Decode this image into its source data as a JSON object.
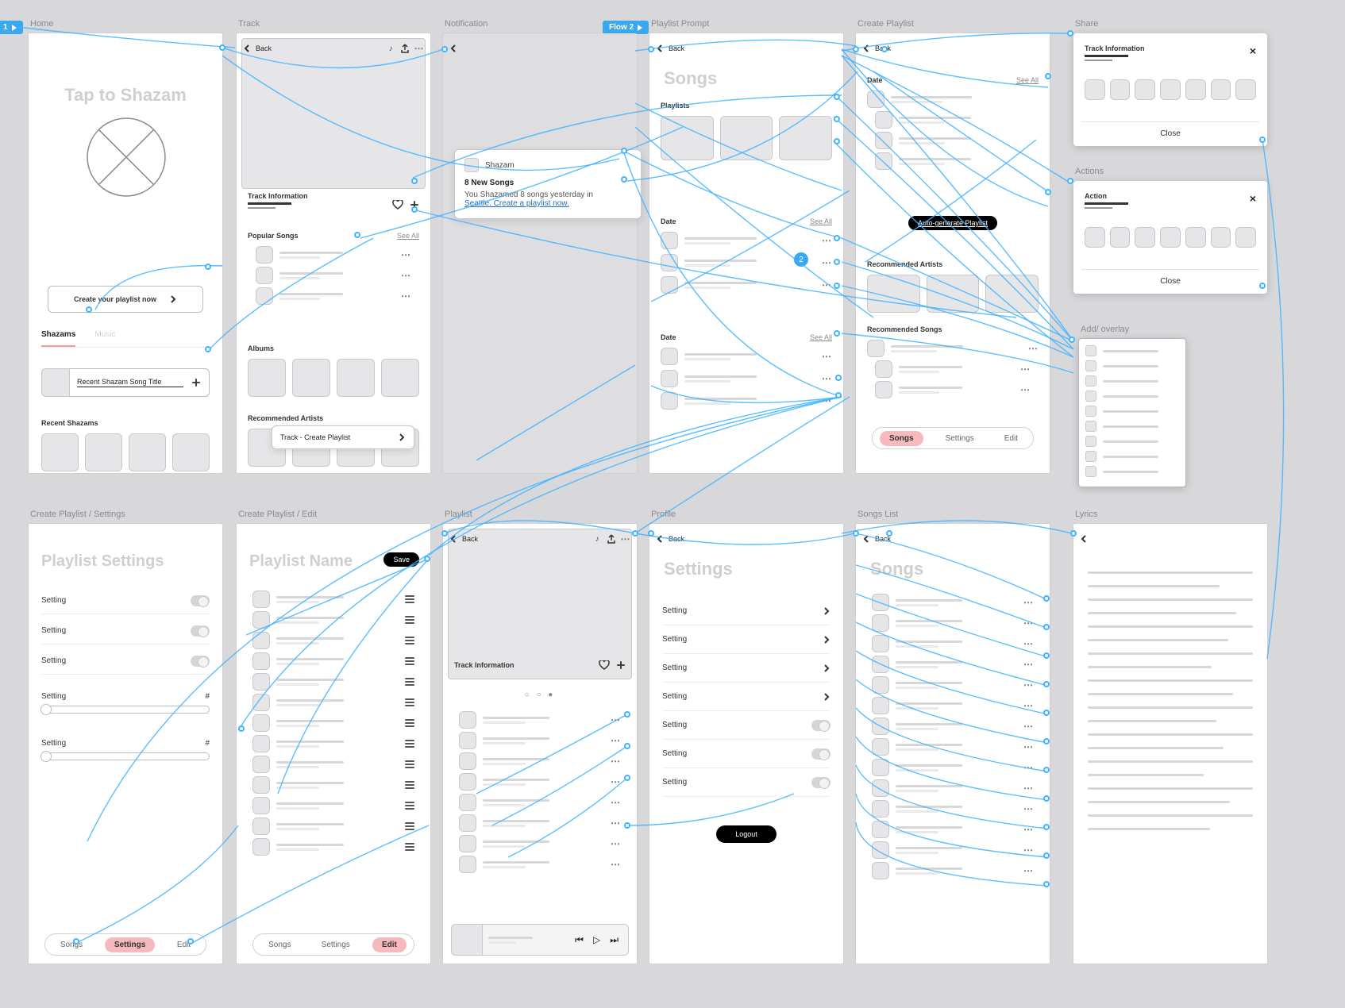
{
  "flowBadges": {
    "flow1": "1",
    "flow2": "Flow 2"
  },
  "stepBadges": {
    "two": "2"
  },
  "common": {
    "backLabel": "Back",
    "seeAll": "See All",
    "close": "Close",
    "trackInfo": "Track Information",
    "tabs": {
      "songs": "Songs",
      "settings": "Settings",
      "edit": "Edit"
    }
  },
  "home": {
    "label": "Home",
    "hero": "Tap to Shazam",
    "cta": "Create your playlist now",
    "tabs": {
      "shazams": "Shazams",
      "music": "Music",
      "other": ""
    },
    "recentRow": "Recent Shazam Song Title",
    "recentSection": "Recent Shazams"
  },
  "track": {
    "label": "Track",
    "popular": "Popular Songs",
    "albums": "Albums",
    "recArtists": "Recommended Artists",
    "popover": "Track - Create Playlist"
  },
  "notification": {
    "label": "Notification",
    "title": "Shazam",
    "subtitle": "8 New Songs",
    "body1": "You Shazamed 8 songs yesterday in",
    "body2": "Seattle. Create a playlist now."
  },
  "playlistPrompt": {
    "label": "Playlist Prompt",
    "heading": "Songs",
    "playlists": "Playlists",
    "date": "Date"
  },
  "createPlaylist": {
    "label": "Create Playlist",
    "date": "Date",
    "cta": "Auto-generate Playlist",
    "recArtists": "Recommended Artists",
    "recSongs": "Recommended Songs"
  },
  "share": {
    "label": "Share",
    "title": "Track Information"
  },
  "actions": {
    "label": "Actions",
    "title": "Action"
  },
  "addOverlay": {
    "label": "Add/ overlay"
  },
  "createSettings": {
    "label": "Create Playlist / Settings",
    "heading": "Playlist Settings",
    "setting": "Setting",
    "hash": "#"
  },
  "createEdit": {
    "label": "Create Playlist / Edit",
    "heading": "Playlist Name",
    "save": "Save"
  },
  "playlist": {
    "label": "Playlist",
    "trackInfo": "Track Information"
  },
  "profile": {
    "label": "Profile",
    "heading": "Settings",
    "setting": "Setting",
    "logout": "Logout"
  },
  "songsList": {
    "label": "Songs List",
    "heading": "Songs"
  },
  "lyrics": {
    "label": "Lyrics"
  }
}
